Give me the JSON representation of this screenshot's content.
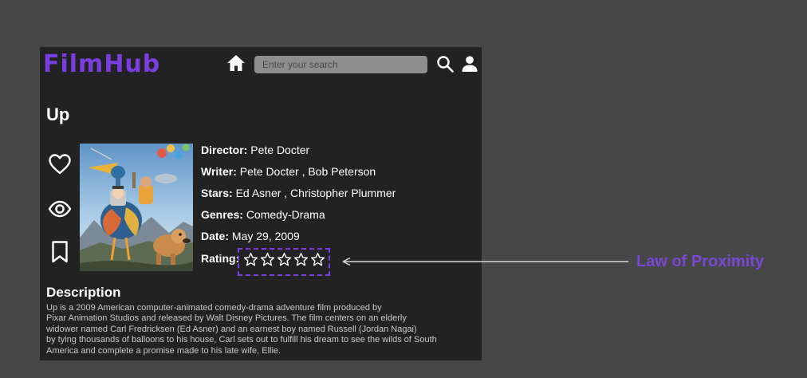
{
  "header": {
    "logo_text": "FilmHub",
    "search_placeholder": "Enter your search"
  },
  "movie": {
    "title": "Up",
    "director_label": "Director:",
    "director": "Pete Docter",
    "writer_label": "Writer:",
    "writer": "Pete Docter , Bob Peterson",
    "stars_label": "Stars:",
    "stars": "Ed Asner , Christopher Plummer",
    "genres_label": "Genres:",
    "genres": "Comedy-Drama",
    "date_label": "Date:",
    "date": "May 29, 2009",
    "rating_label": "Rating:",
    "rating_value": 0,
    "rating_max": 5
  },
  "description": {
    "title": "Description",
    "lines": [
      "Up is a 2009 American computer-animated comedy-drama adventure film produced by",
      "Pixar Animation Studios and released by Walt Disney Pictures. The film centers on an elderly",
      "widower named Carl Fredricksen (Ed Asner) and an earnest boy named Russell (Jordan Nagai)",
      "by tying thousands of balloons to his house, Carl sets out to fulfill his dream to see the wilds of South",
      "America and complete a promise made to his late wife, Ellie."
    ]
  },
  "annotation": {
    "label": "Law of Proximity",
    "color": "#7a48d6"
  },
  "colors": {
    "background": "#474747",
    "panel": "#232223",
    "accent": "#7a3ee0"
  },
  "icons": [
    "home-icon",
    "search-icon",
    "user-icon",
    "heart-icon",
    "eye-icon",
    "bookmark-icon",
    "star-icon"
  ]
}
